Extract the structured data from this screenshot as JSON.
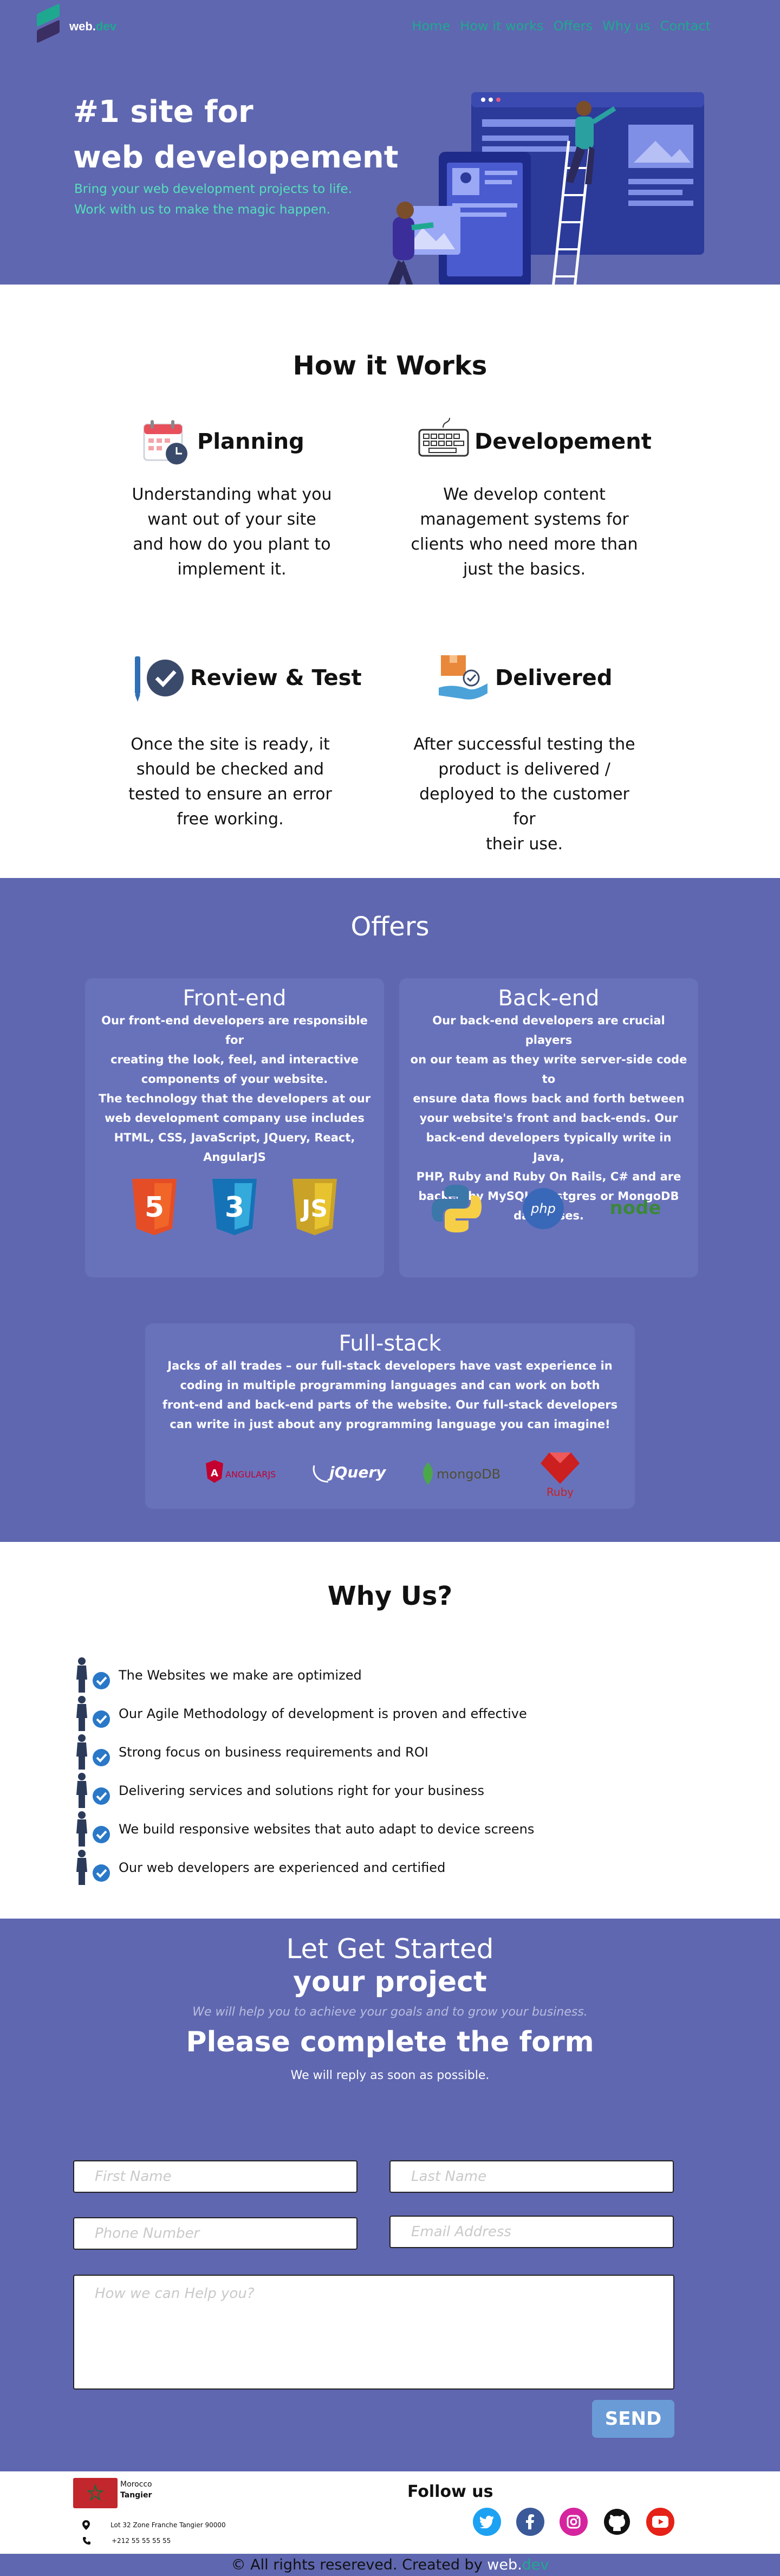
{
  "brand": {
    "name_web": "web.",
    "name_dev": "dev"
  },
  "nav": {
    "items": [
      "Home",
      "How it works",
      "Offers",
      "Why us",
      "Contact"
    ]
  },
  "hero": {
    "title_line1": "#1 site for",
    "title_line2": "web developement",
    "subtitle_line1": "Bring your web development projects to life.",
    "subtitle_line2": "Work with us to make the magic happen."
  },
  "how": {
    "title": "How it Works",
    "steps": [
      {
        "title": "Planning",
        "icon": "calendar-clock-icon",
        "text": [
          "Understanding what you",
          "want out of your site",
          "and how do you plant to",
          "implement it."
        ]
      },
      {
        "title": "Developement",
        "icon": "keyboard-icon",
        "text": [
          "We develop content",
          "management systems for",
          "clients who need more than",
          "just the basics."
        ]
      },
      {
        "title": "Review & Test",
        "icon": "pen-check-icon",
        "text": [
          "Once the site is ready, it",
          "should be checked and",
          "tested to ensure an error",
          "free working."
        ]
      },
      {
        "title": "Delivered",
        "icon": "package-hand-icon",
        "text": [
          "After successful testing the",
          "product is delivered /",
          "deployed to the customer for",
          "their use."
        ]
      }
    ]
  },
  "offers": {
    "title": "Offers",
    "frontend": {
      "title": "Front-end",
      "text": [
        "Our front-end developers are responsible for",
        "creating the look, feel, and interactive",
        "components of your website.",
        "The technology that the developers at our",
        "web development company use includes",
        "HTML, CSS, JavaScript, JQuery, React,",
        "AngularJS"
      ],
      "logos": [
        "html5-icon",
        "css3-icon",
        "javascript-icon"
      ]
    },
    "backend": {
      "title": "Back-end",
      "text": [
        "Our back-end developers are crucial players",
        "on our team as they write server-side code to",
        "ensure data flows back and forth between",
        "your website's front and back-ends. Our",
        "back-end developers typically write in Java,",
        "PHP, Ruby and Ruby On Rails, C# and are",
        "backed by MySQL, Postgres or MongoDB",
        "databases."
      ],
      "logos": [
        "python-icon",
        "php-icon",
        "nodejs-icon"
      ],
      "php_label": "php",
      "node_label": "node"
    },
    "fullstack": {
      "title": "Full-stack",
      "text": [
        "Jacks of all trades – our full-stack developers have vast experience in",
        "coding in multiple programming languages and can work on both",
        "front-end and back-end parts of the website. Our full-stack developers",
        "can write in just about any programming language you can imagine!"
      ],
      "angular_label": "ANGULARJS",
      "jquery_label": "jQuery",
      "mongo_label": "mongoDB",
      "ruby_label": "Ruby"
    }
  },
  "why": {
    "title": "Why Us?",
    "items": [
      "The Websites we make are optimized",
      "Our Agile Methodology of development is proven and effective",
      "Strong focus on business requirements and ROI",
      "Delivering services and solutions right for your business",
      "We build responsive websites that auto adapt to device screens",
      "Our web developers are experienced and certified"
    ]
  },
  "contact": {
    "line1": "Let Get Started",
    "line2": "your project",
    "line3": "We will help you to achieve your goals and to grow your business.",
    "line4": "Please complete the form",
    "line5": "We will reply as soon as possible.",
    "first_name_placeholder": "First Name",
    "last_name_placeholder": "Last Name",
    "phone_placeholder": "Phone Number",
    "email_placeholder": "Email Address",
    "message_placeholder": "How we can Help you?",
    "send_label": "SEND"
  },
  "footer": {
    "country": "Morocco",
    "city": "Tangier",
    "address": "Lot 32  Zone Franche Tangier 90000",
    "phone": "+212 55 55 55 55",
    "follow": "Follow us",
    "copyright": "© All rights resereved. Created by ",
    "socials": [
      "twitter-icon",
      "facebook-icon",
      "instagram-icon",
      "github-icon",
      "youtube-icon"
    ]
  }
}
